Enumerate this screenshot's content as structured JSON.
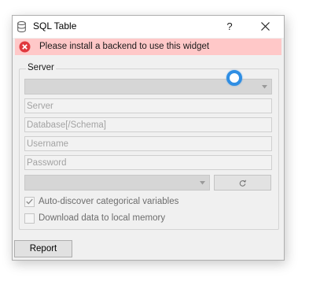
{
  "window": {
    "title": "SQL Table",
    "help_label": "?",
    "colors": {
      "error_bg": "#ffc8c8",
      "error_icon": "#e0393e",
      "spinner": "#2f8ee3"
    }
  },
  "error": {
    "message": "Please install a backend to use this widget"
  },
  "server_group": {
    "title": "Server",
    "backend_select": {
      "value": ""
    },
    "fields": {
      "server_placeholder": "Server",
      "database_placeholder": "Database[/Schema]",
      "username_placeholder": "Username",
      "password_placeholder": "Password"
    },
    "table_select": {
      "value": ""
    },
    "checkboxes": [
      {
        "label": "Auto-discover categorical variables",
        "checked": true
      },
      {
        "label": "Download data to local memory",
        "checked": false
      }
    ]
  },
  "footer": {
    "report_label": "Report"
  },
  "icons": {
    "app": "database-icon",
    "close": "close-icon",
    "error": "error-icon",
    "refresh": "refresh-icon",
    "busy": "spinner-icon"
  }
}
